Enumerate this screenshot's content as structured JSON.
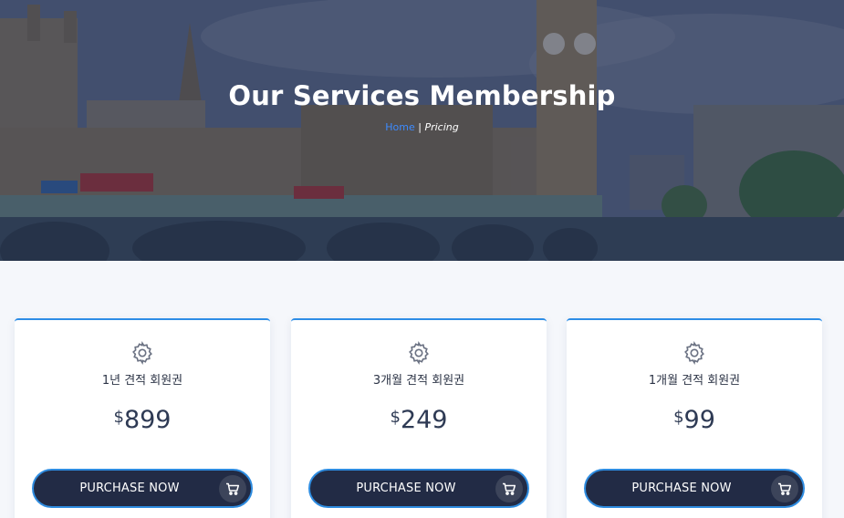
{
  "hero": {
    "title": "Our Services Membership",
    "breadcrumb": {
      "home": "Home",
      "separator": "|",
      "current": "Pricing"
    }
  },
  "plans": [
    {
      "name": "1년 견적 회원권",
      "currency": "$",
      "price": "899",
      "button": "PURCHASE NOW",
      "icon": "gear-icon",
      "cart_icon": "cart-icon"
    },
    {
      "name": "3개월 견적 회원권",
      "currency": "$",
      "price": "249",
      "button": "PURCHASE NOW",
      "icon": "gear-icon",
      "cart_icon": "cart-icon"
    },
    {
      "name": "1개월 견적 회원권",
      "currency": "$",
      "price": "99",
      "button": "PURCHASE NOW",
      "icon": "gear-icon",
      "cart_icon": "cart-icon"
    }
  ],
  "colors": {
    "accent": "#2d8de6",
    "button_bg": "#222b45",
    "link": "#3d8bff",
    "price_text": "#2e3a54"
  }
}
